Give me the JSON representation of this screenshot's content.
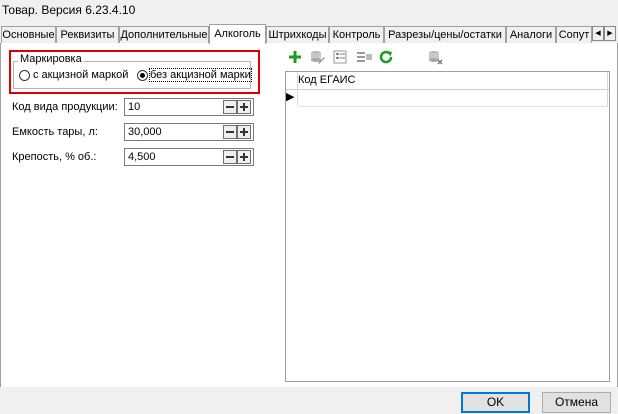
{
  "window": {
    "title": "Товар. Версия 6.23.4.10"
  },
  "tabs": [
    "Основные",
    "Реквизиты",
    "Дополнительные",
    "Алкоголь",
    "Штрихкоды",
    "Контроль",
    "Разрезы/цены/остатки",
    "Аналоги",
    "Сопут"
  ],
  "active_tab": "Алкоголь",
  "marking": {
    "group_label": "Маркировка",
    "option_excise": "с акцизной маркой",
    "option_no_excise": "без акцизной марки",
    "selected": "без акцизной марки"
  },
  "fields": {
    "product_type": {
      "label": "Код вида продукции:",
      "value": "10"
    },
    "capacity": {
      "label": "Емкость тары, л:",
      "value": "30,000"
    },
    "strength": {
      "label": "Крепость, % об.:",
      "value": "4,500"
    }
  },
  "toolbar_icons": [
    "add-icon",
    "edit-icon",
    "properties-icon",
    "list-icon",
    "refresh-icon",
    "delete-icon"
  ],
  "grid": {
    "column": "Код ЕГАИС",
    "row_marker": "▶"
  },
  "buttons": {
    "ok": "OK",
    "cancel": "Отмена"
  },
  "colors": {
    "highlight": "#e00000",
    "add": "#1a9e1a",
    "refresh": "#1a9e1a",
    "default_button": "#0078d7"
  }
}
